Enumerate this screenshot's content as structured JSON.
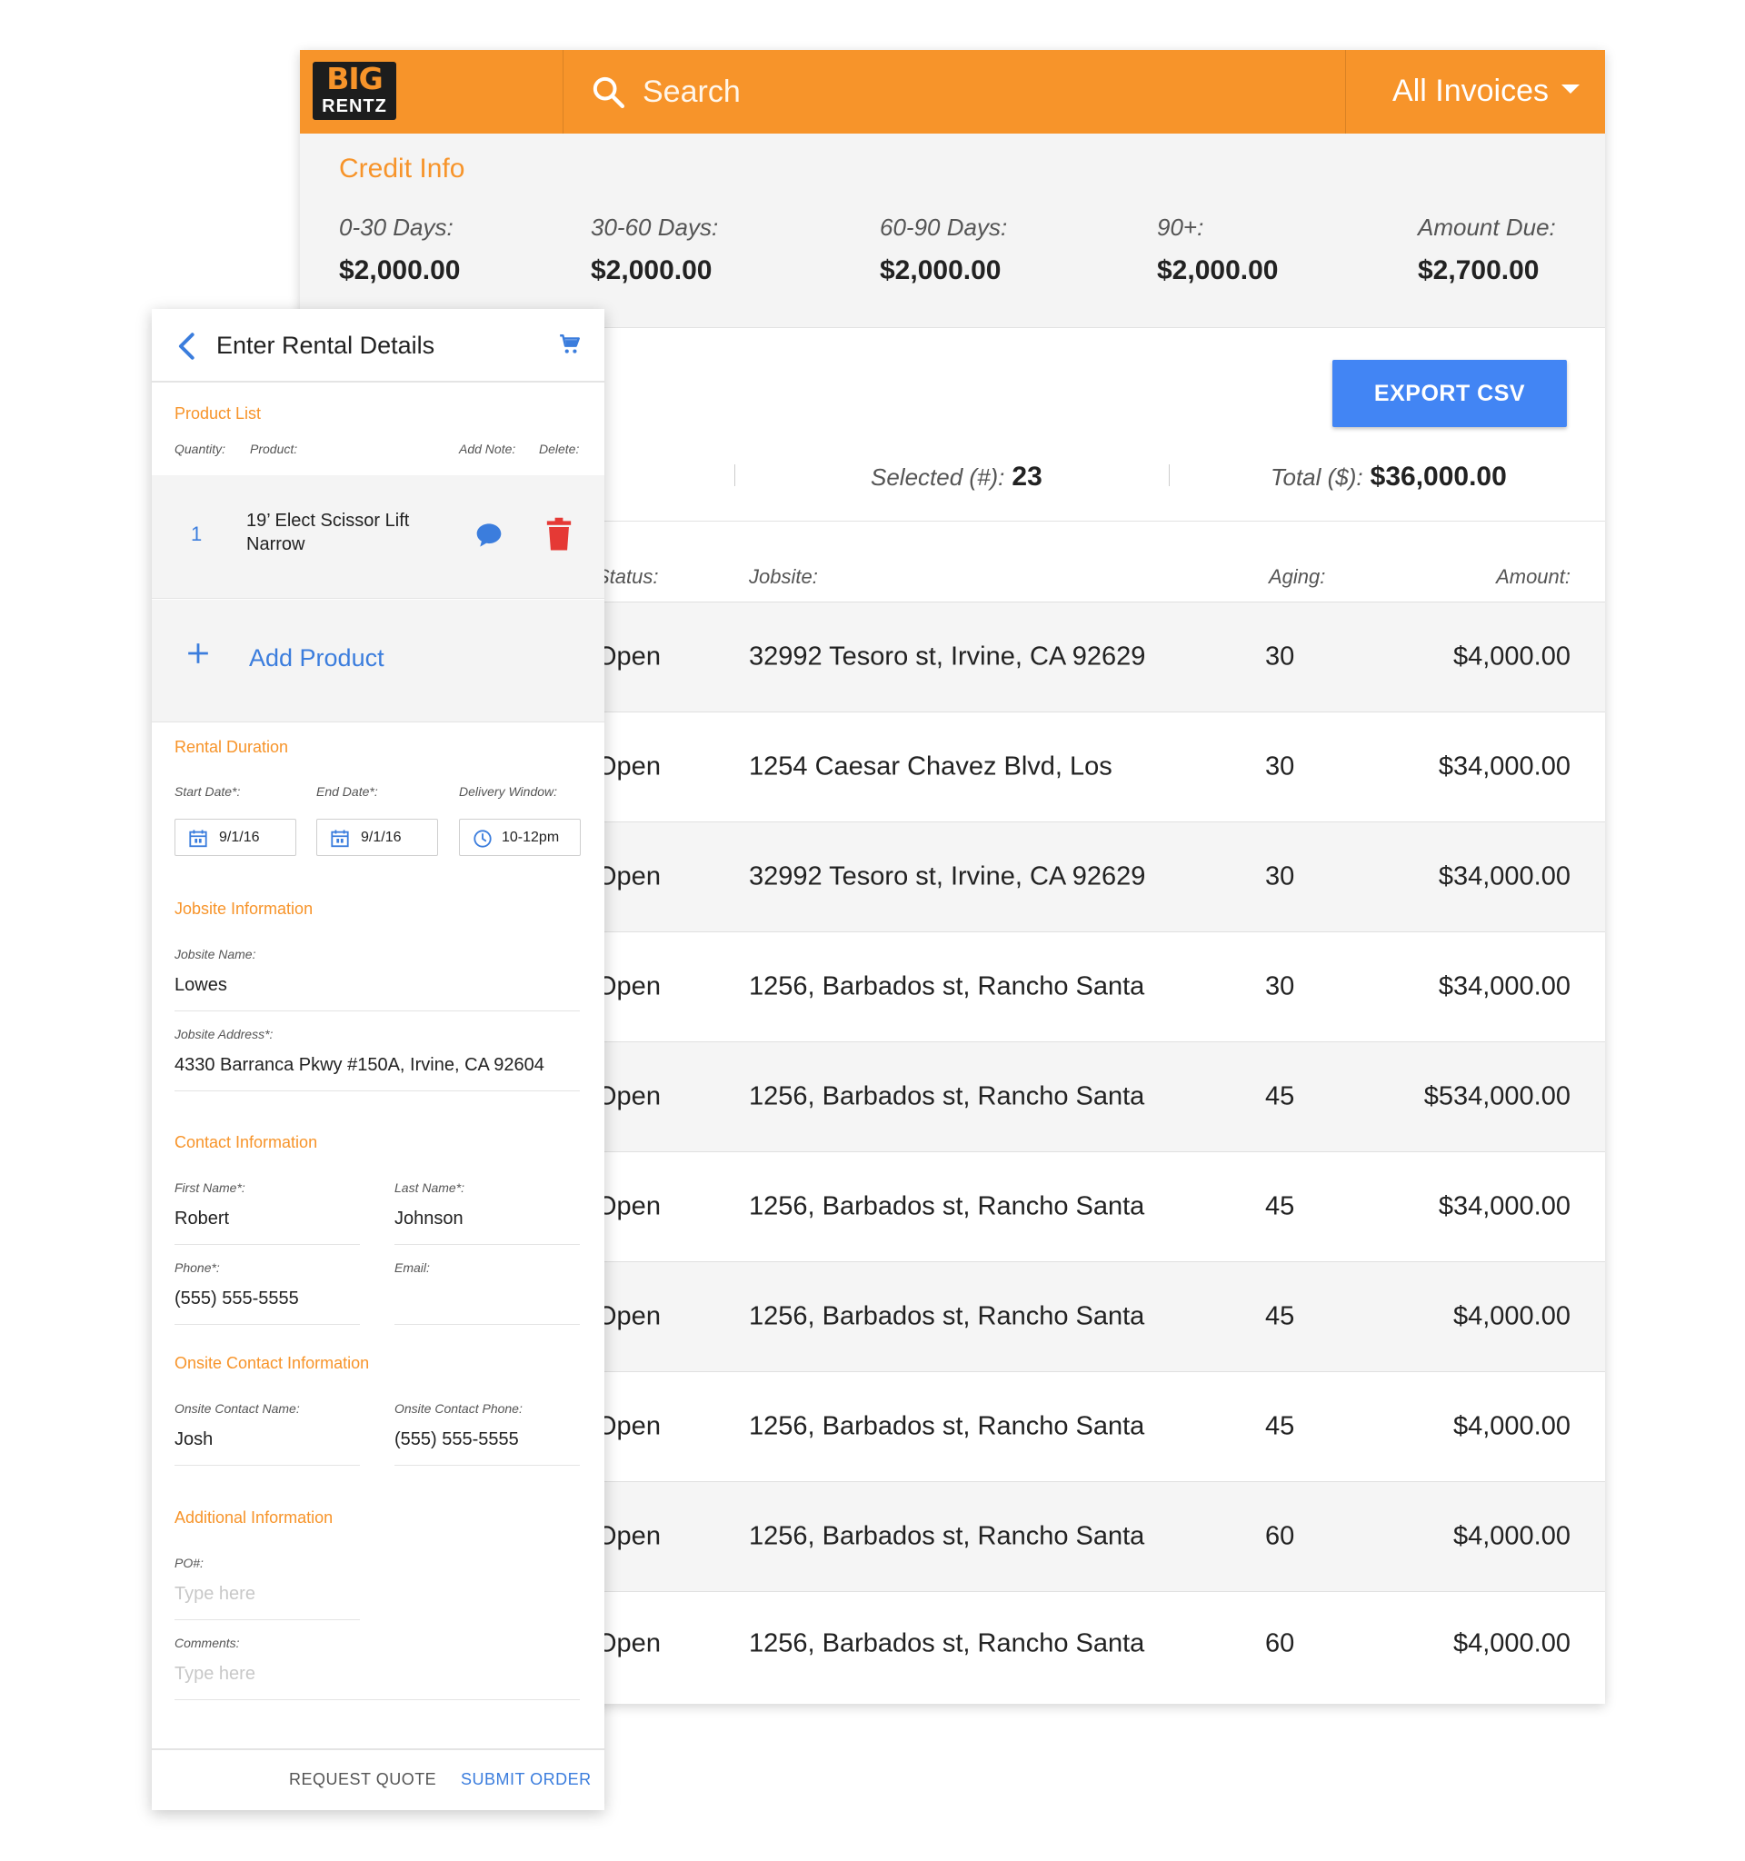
{
  "header": {
    "logo_big": "BIG",
    "logo_rentz": "RENTZ",
    "search_placeholder": "Search",
    "filter_label": "All Invoices",
    "colors": {
      "brand": "#f7942a",
      "accent": "#4285f4"
    }
  },
  "credit": {
    "title": "Credit Info",
    "buckets": [
      {
        "label": "0-30 Days:",
        "value": "$2,000.00"
      },
      {
        "label": "30-60 Days:",
        "value": "$2,000.00"
      },
      {
        "label": "60-90 Days:",
        "value": "$2,000.00"
      },
      {
        "label": "90+:",
        "value": "$2,000.00"
      },
      {
        "label": "Amount Due:",
        "value": "$2,700.00"
      }
    ]
  },
  "actions": {
    "export_label": "EXPORT CSV"
  },
  "summary": {
    "selected_label": "Selected (#):",
    "selected_value": "23",
    "total_label": "Total ($):",
    "total_value": "$36,000.00"
  },
  "table": {
    "headers": {
      "status": "Status:",
      "jobsite": "Jobsite:",
      "aging": "Aging:",
      "amount": "Amount:"
    },
    "rows": [
      {
        "status": "Open",
        "jobsite": "32992 Tesoro st, Irvine, CA 92629",
        "aging": "30",
        "amount": "$4,000.00"
      },
      {
        "status": "Open",
        "jobsite": "1254 Caesar Chavez Blvd, Los",
        "aging": "30",
        "amount": "$34,000.00"
      },
      {
        "status": "Open",
        "jobsite": "32992 Tesoro st, Irvine, CA 92629",
        "aging": "30",
        "amount": "$34,000.00"
      },
      {
        "status": "Open",
        "jobsite": "1256, Barbados st, Rancho Santa",
        "aging": "30",
        "amount": "$34,000.00"
      },
      {
        "status": "Open",
        "jobsite": "1256, Barbados st, Rancho Santa",
        "aging": "45",
        "amount": "$534,000.00"
      },
      {
        "status": "Open",
        "jobsite": "1256, Barbados st, Rancho Santa",
        "aging": "45",
        "amount": "$34,000.00"
      },
      {
        "status": "Open",
        "jobsite": "1256, Barbados st, Rancho Santa",
        "aging": "45",
        "amount": "$4,000.00"
      },
      {
        "status": "Open",
        "jobsite": "1256, Barbados st, Rancho Santa",
        "aging": "45",
        "amount": "$4,000.00"
      },
      {
        "status": "Open",
        "jobsite": "1256, Barbados st, Rancho Santa",
        "aging": "60",
        "amount": "$4,000.00"
      },
      {
        "status": "Open",
        "jobsite": "1256, Barbados st, Rancho Santa",
        "aging": "60",
        "amount": "$4,000.00"
      }
    ]
  },
  "rental": {
    "title": "Enter Rental Details",
    "product_list": {
      "title": "Product List",
      "col_quantity": "Quantity:",
      "col_product": "Product:",
      "col_note": "Add Note:",
      "col_delete": "Delete:",
      "items": [
        {
          "quantity": "1",
          "name": "19’ Elect Scissor Lift Narrow"
        }
      ],
      "add_label": "Add Product"
    },
    "duration": {
      "title": "Rental Duration",
      "start_label": "Start Date*:",
      "start_value": "9/1/16",
      "end_label": "End Date*:",
      "end_value": "9/1/16",
      "window_label": "Delivery Window:",
      "window_value": "10-12pm"
    },
    "jobsite": {
      "title": "Jobsite Information",
      "name_label": "Jobsite Name:",
      "name_value": "Lowes",
      "address_label": "Jobsite Address*:",
      "address_value": "4330 Barranca Pkwy #150A, Irvine, CA 92604"
    },
    "contact": {
      "title": "Contact Information",
      "first_label": "First Name*:",
      "first_value": "Robert",
      "last_label": "Last Name*:",
      "last_value": "Johnson",
      "phone_label": "Phone*:",
      "phone_value": "(555) 555-5555",
      "email_label": "Email:",
      "email_value": ""
    },
    "onsite": {
      "title": "Onsite Contact Information",
      "name_label": "Onsite Contact Name:",
      "name_value": "Josh",
      "phone_label": "Onsite Contact Phone:",
      "phone_value": "(555) 555-5555"
    },
    "additional": {
      "title": "Additional Information",
      "po_label": "PO#:",
      "po_placeholder": "Type here",
      "comments_label": "Comments:",
      "comments_placeholder": "Type here"
    },
    "footer": {
      "quote_label": "REQUEST QUOTE",
      "submit_label": "SUBMIT ORDER"
    }
  }
}
